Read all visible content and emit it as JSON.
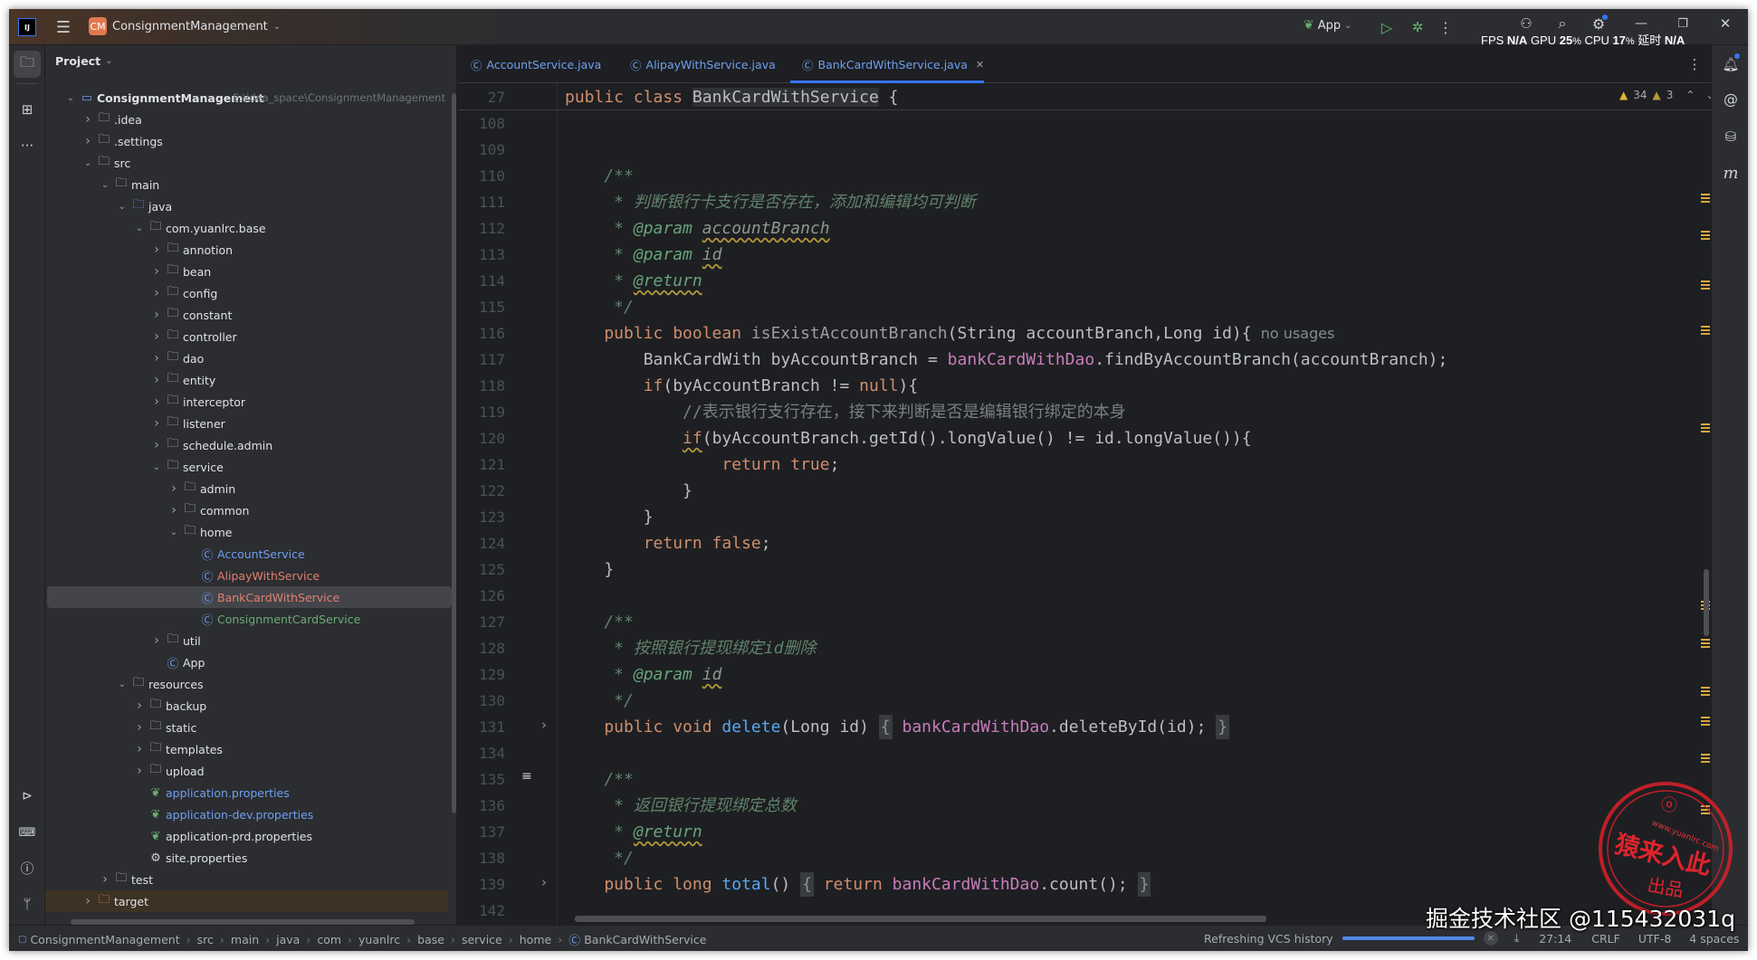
{
  "titlebar": {
    "project_badge": "CM",
    "project_name": "ConsignmentManagement",
    "run_config": "App"
  },
  "perf_overlay": {
    "fps_label": "FPS",
    "fps_value": "N/A",
    "gpu_label": "GPU",
    "gpu_value": "25",
    "cpu_label": "CPU",
    "cpu_value": "17",
    "pct": "%",
    "latency_label": "延时",
    "latency_value": "N/A"
  },
  "project_panel": {
    "title": "Project",
    "root_path": "E:\\idea_space\\ConsignmentManagement",
    "items": [
      {
        "label": "ConsignmentManagement",
        "level": 0,
        "kind": "module",
        "expanded": true,
        "bold": true
      },
      {
        "label": ".idea",
        "level": 1,
        "kind": "folder",
        "expanded": false
      },
      {
        "label": ".settings",
        "level": 1,
        "kind": "folder",
        "expanded": false
      },
      {
        "label": "src",
        "level": 1,
        "kind": "folder",
        "expanded": true
      },
      {
        "label": "main",
        "level": 2,
        "kind": "folder",
        "expanded": true
      },
      {
        "label": "java",
        "level": 3,
        "kind": "srcfolder",
        "expanded": true
      },
      {
        "label": "com.yuanlrc.base",
        "level": 4,
        "kind": "package",
        "expanded": true
      },
      {
        "label": "annotion",
        "level": 5,
        "kind": "package",
        "expanded": false
      },
      {
        "label": "bean",
        "level": 5,
        "kind": "package",
        "expanded": false
      },
      {
        "label": "config",
        "level": 5,
        "kind": "package",
        "expanded": false
      },
      {
        "label": "constant",
        "level": 5,
        "kind": "package",
        "expanded": false
      },
      {
        "label": "controller",
        "level": 5,
        "kind": "package",
        "expanded": false
      },
      {
        "label": "dao",
        "level": 5,
        "kind": "package",
        "expanded": false
      },
      {
        "label": "entity",
        "level": 5,
        "kind": "package",
        "expanded": false
      },
      {
        "label": "interceptor",
        "level": 5,
        "kind": "package",
        "expanded": false
      },
      {
        "label": "listener",
        "level": 5,
        "kind": "package",
        "expanded": false
      },
      {
        "label": "schedule.admin",
        "level": 5,
        "kind": "package",
        "expanded": false
      },
      {
        "label": "service",
        "level": 5,
        "kind": "package",
        "expanded": true
      },
      {
        "label": "admin",
        "level": 6,
        "kind": "package",
        "expanded": false
      },
      {
        "label": "common",
        "level": 6,
        "kind": "package",
        "expanded": false
      },
      {
        "label": "home",
        "level": 6,
        "kind": "package",
        "expanded": true
      },
      {
        "label": "AccountService",
        "level": 7,
        "kind": "class",
        "color": "#6f9ff0"
      },
      {
        "label": "AlipayWithService",
        "level": 7,
        "kind": "class",
        "color": "#e0806f"
      },
      {
        "label": "BankCardWithService",
        "level": 7,
        "kind": "class",
        "color": "#e0806f",
        "selected": true
      },
      {
        "label": "ConsignmentCardService",
        "level": 7,
        "kind": "class",
        "color": "#6aab73"
      },
      {
        "label": "util",
        "level": 5,
        "kind": "package",
        "expanded": false
      },
      {
        "label": "App",
        "level": 5,
        "kind": "springclass"
      },
      {
        "label": "resources",
        "level": 3,
        "kind": "resfolder",
        "expanded": true
      },
      {
        "label": "backup",
        "level": 4,
        "kind": "folder",
        "expanded": false
      },
      {
        "label": "static",
        "level": 4,
        "kind": "folder",
        "expanded": false
      },
      {
        "label": "templates",
        "level": 4,
        "kind": "folder",
        "expanded": false
      },
      {
        "label": "upload",
        "level": 4,
        "kind": "folder",
        "expanded": false
      },
      {
        "label": "application.properties",
        "level": 4,
        "kind": "spring",
        "color": "#6f9ff0"
      },
      {
        "label": "application-dev.properties",
        "level": 4,
        "kind": "spring",
        "color": "#6f9ff0"
      },
      {
        "label": "application-prd.properties",
        "level": 4,
        "kind": "spring"
      },
      {
        "label": "site.properties",
        "level": 4,
        "kind": "settings"
      },
      {
        "label": "test",
        "level": 2,
        "kind": "folder",
        "expanded": false
      },
      {
        "label": "target",
        "level": 1,
        "kind": "excluded",
        "expanded": false,
        "excluded": true
      }
    ]
  },
  "tabs": [
    {
      "label": "AccountService.java",
      "active": false
    },
    {
      "label": "AlipayWithService.java",
      "active": false
    },
    {
      "label": "BankCardWithService.java",
      "active": true
    }
  ],
  "inspections": {
    "warnings": "34",
    "weak_warnings": "3"
  },
  "editor": {
    "lines": [
      {
        "n": "27",
        "t": [
          [
            "public class ",
            "kw"
          ],
          [
            "BankCardWithService",
            "hl"
          ],
          [
            " {",
            ""
          ]
        ]
      },
      {
        "n": "108",
        "t": []
      },
      {
        "n": "109",
        "t": []
      },
      {
        "n": "110",
        "t": [
          [
            "    /**",
            "doc"
          ]
        ]
      },
      {
        "n": "111",
        "t": [
          [
            "     * 判断银行卡支行是否存在，添加和编辑均可判断",
            "doc"
          ]
        ]
      },
      {
        "n": "112",
        "t": [
          [
            "     * ",
            "doc"
          ],
          [
            "@param",
            "tagp"
          ],
          [
            " ",
            "doc"
          ],
          [
            "accountBranch",
            "dp"
          ]
        ]
      },
      {
        "n": "113",
        "t": [
          [
            "     * ",
            "doc"
          ],
          [
            "@param",
            "tagp"
          ],
          [
            " ",
            "doc"
          ],
          [
            "id",
            "dp"
          ]
        ]
      },
      {
        "n": "114",
        "t": [
          [
            "     * ",
            "doc"
          ],
          [
            "@return",
            "tag"
          ]
        ]
      },
      {
        "n": "115",
        "t": [
          [
            "     */",
            "doc"
          ]
        ]
      },
      {
        "n": "116",
        "t": [
          [
            "    public boolean ",
            "kw"
          ],
          [
            "isExistAccountBranch",
            "unused"
          ],
          [
            "(String accountBranch,Long id){",
            ""
          ],
          [
            "  no usages",
            "hint"
          ]
        ]
      },
      {
        "n": "117",
        "t": [
          [
            "        BankCardWith byAccountBranch = ",
            ""
          ],
          [
            "bankCardWithDao",
            "fld"
          ],
          [
            ".findByAccountBranch(accountBranch);",
            ""
          ]
        ]
      },
      {
        "n": "118",
        "t": [
          [
            "        ",
            ""
          ],
          [
            "if",
            "kw"
          ],
          [
            "(byAccountBranch != ",
            ""
          ],
          [
            "null",
            "kw"
          ],
          [
            "){",
            ""
          ]
        ]
      },
      {
        "n": "119",
        "t": [
          [
            "            //表示银行支行存在，接下来判断是否是编辑银行绑定的本身",
            "cm"
          ]
        ]
      },
      {
        "n": "120",
        "t": [
          [
            "            ",
            ""
          ],
          [
            "if",
            "kw warn"
          ],
          [
            "(byAccountBranch.getId().longValue() != id.longValue()){",
            ""
          ]
        ]
      },
      {
        "n": "121",
        "t": [
          [
            "                ",
            ""
          ],
          [
            "return true",
            "kw"
          ],
          [
            ";",
            ""
          ]
        ]
      },
      {
        "n": "122",
        "t": [
          [
            "            }",
            ""
          ]
        ]
      },
      {
        "n": "123",
        "t": [
          [
            "        }",
            ""
          ]
        ]
      },
      {
        "n": "124",
        "t": [
          [
            "        ",
            ""
          ],
          [
            "return false",
            "kw"
          ],
          [
            ";",
            ""
          ]
        ]
      },
      {
        "n": "125",
        "t": [
          [
            "    }",
            ""
          ]
        ]
      },
      {
        "n": "126",
        "t": []
      },
      {
        "n": "127",
        "t": [
          [
            "    /**",
            "doc"
          ]
        ]
      },
      {
        "n": "128",
        "t": [
          [
            "     * 按照银行提现绑定id删除",
            "doc"
          ]
        ]
      },
      {
        "n": "129",
        "t": [
          [
            "     * ",
            "doc"
          ],
          [
            "@param",
            "tagp"
          ],
          [
            " ",
            "doc"
          ],
          [
            "id",
            "dp"
          ]
        ]
      },
      {
        "n": "130",
        "t": [
          [
            "     */",
            "doc"
          ]
        ]
      },
      {
        "n": "131",
        "fold": true,
        "t": [
          [
            "    public void ",
            "kw"
          ],
          [
            "delete",
            "decl"
          ],
          [
            "(Long id) ",
            ""
          ],
          [
            "{",
            "fold"
          ],
          [
            " ",
            ""
          ],
          [
            "bankCardWithDao",
            "fld"
          ],
          [
            ".deleteById(id);",
            ""
          ],
          [
            " ",
            ""
          ],
          [
            "}",
            "fold"
          ]
        ]
      },
      {
        "n": "134",
        "t": []
      },
      {
        "n": "135",
        "doc_toggle": true,
        "t": [
          [
            "    /**",
            "doc"
          ]
        ]
      },
      {
        "n": "136",
        "t": [
          [
            "     * 返回银行提现绑定总数",
            "doc"
          ]
        ]
      },
      {
        "n": "137",
        "t": [
          [
            "     * ",
            "doc"
          ],
          [
            "@return",
            "tag"
          ]
        ]
      },
      {
        "n": "138",
        "t": [
          [
            "     */",
            "doc"
          ]
        ]
      },
      {
        "n": "139",
        "fold": true,
        "t": [
          [
            "    public long ",
            "kw"
          ],
          [
            "total",
            "decl"
          ],
          [
            "() ",
            ""
          ],
          [
            "{",
            "fold"
          ],
          [
            " ",
            ""
          ],
          [
            "return ",
            "kw"
          ],
          [
            "bankCardWithDao",
            "fld"
          ],
          [
            ".count();",
            ""
          ],
          [
            " ",
            ""
          ],
          [
            "}",
            "fold"
          ]
        ]
      },
      {
        "n": "142",
        "t": []
      }
    ]
  },
  "statusbar": {
    "breadcrumbs": [
      "ConsignmentManagement",
      "src",
      "main",
      "java",
      "com",
      "yuanlrc",
      "base",
      "service",
      "home",
      "BankCardWithService"
    ],
    "task": "Refreshing VCS history",
    "task_progress": 1.0,
    "cursor": "27:14",
    "line_sep": "CRLF",
    "encoding": "UTF-8",
    "indent": "4 spaces"
  },
  "watermark": {
    "text": "掘金技术社区 @115432031q",
    "stamp_url": "www.yuanlrc.com",
    "stamp_main": "猿来入此",
    "stamp_sub": "出品"
  },
  "colors": {
    "accent": "#3574f0",
    "keyword": "#cf8e6d",
    "method": "#56a8f5",
    "field": "#c77dbb",
    "doc": "#5f826b",
    "stamp": "#d0202a"
  }
}
